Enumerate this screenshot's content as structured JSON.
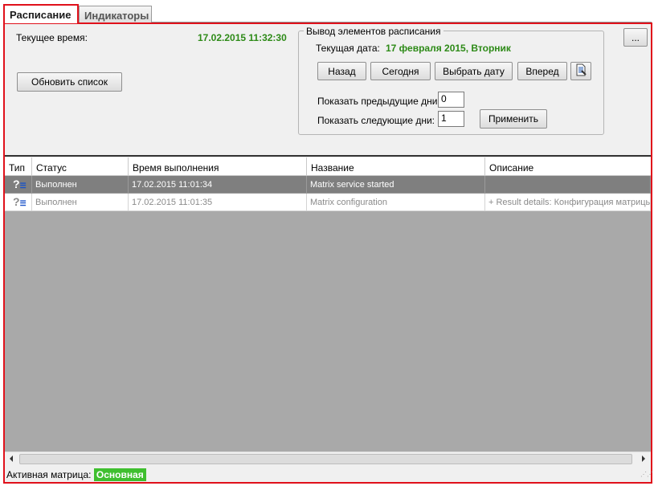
{
  "tabs": [
    {
      "label": "Расписание",
      "active": true
    },
    {
      "label": "Индикаторы",
      "active": false
    }
  ],
  "top": {
    "current_time_label": "Текущее время:",
    "current_time_value": "17.02.2015 11:32:30",
    "refresh_button": "Обновить список",
    "more_button": "..."
  },
  "schedule_group": {
    "legend": "Вывод элементов расписания",
    "current_date_label": "Текущая дата:",
    "current_date_value": "17 февраля 2015, Вторник",
    "buttons": {
      "back": "Назад",
      "today": "Сегодня",
      "pick_date": "Выбрать дату",
      "forward": "Вперед"
    },
    "prev_days_label": "Показать предыдущие дни:",
    "prev_days_value": "0",
    "next_days_label": "Показать следующие дни:",
    "next_days_value": "1",
    "apply_button": "Применить"
  },
  "grid": {
    "columns": [
      "Тип",
      "Статус",
      "Время выполнения",
      "Название",
      "Описание"
    ],
    "rows": [
      {
        "type_icon": "?",
        "status": "Выполнен",
        "time": "17.02.2015 11:01:34",
        "name": "Matrix service started",
        "description": "",
        "selected": true
      },
      {
        "type_icon": "?",
        "status": "Выполнен",
        "time": "17.02.2015 11:01:35",
        "name": "Matrix configuration",
        "description": "+ Result details: Конфигурация матрицы",
        "selected": false
      }
    ]
  },
  "statusbar": {
    "active_matrix_label": "Активная матрица:",
    "active_matrix_value": "Основная"
  },
  "colors": {
    "accent_red": "#e0111b",
    "green": "#2d8a17",
    "badge_green": "#3fbf2f"
  }
}
